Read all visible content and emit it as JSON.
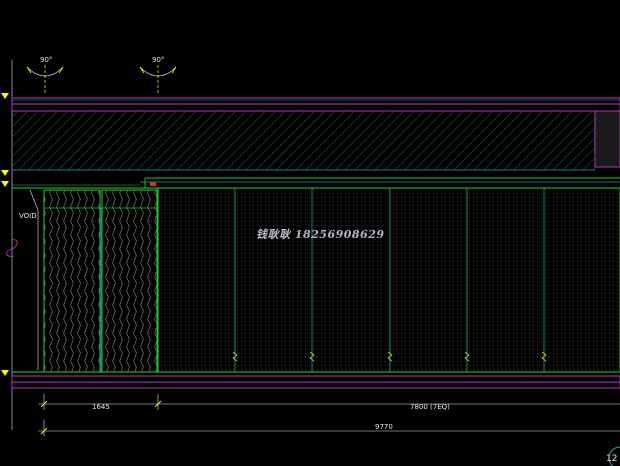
{
  "drawing": {
    "angle_labels": [
      "90°",
      "90°"
    ],
    "side_label": "VOID",
    "door_label": "",
    "dimensions": {
      "left_span": "1645",
      "right_span": "7800 (7EQ)",
      "total_span": "9770"
    },
    "watermark": "钱耿耿 18256908629",
    "sheet_marker": "12",
    "colors": {
      "background": "#000000",
      "magenta": "#c030c0",
      "green": "#20d020",
      "teal": "#20a8a0",
      "yellow": "#ffff00",
      "white": "#e8e8e8",
      "hatch": "#0d5a55",
      "dots": "#2a2a2a"
    }
  }
}
